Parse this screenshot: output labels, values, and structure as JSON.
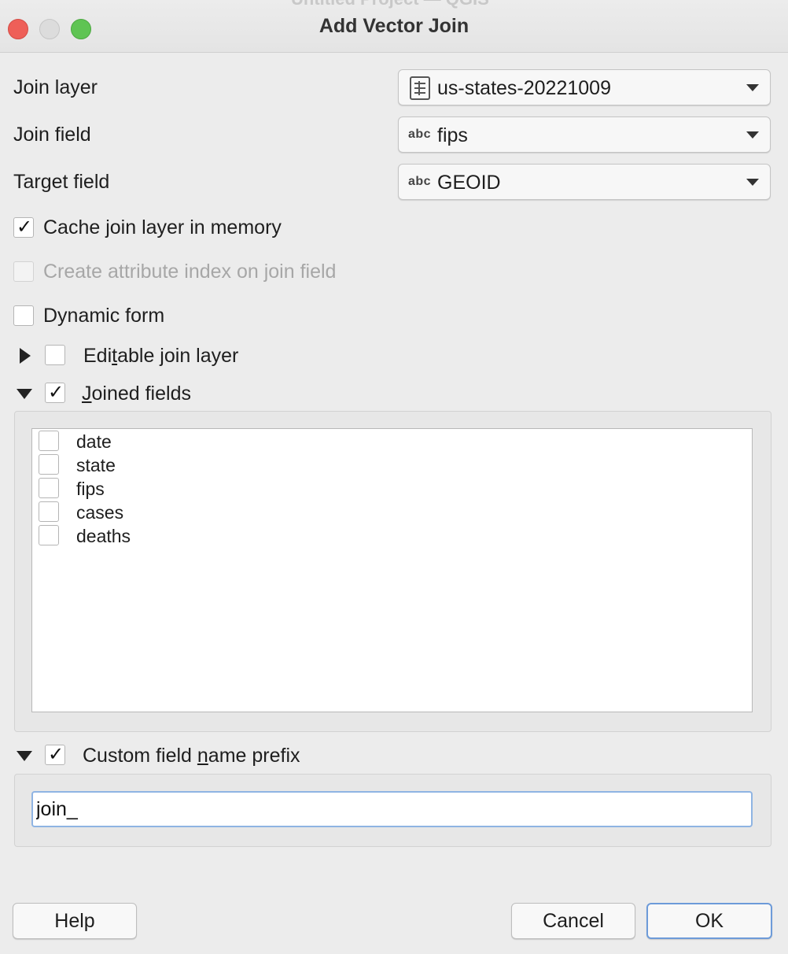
{
  "window": {
    "title": "Add Vector Join",
    "background_title": "Untitled Project — QGIS"
  },
  "form": {
    "join_layer": {
      "label": "Join layer",
      "value": "us-states-20221009",
      "icon": "table-layer-icon"
    },
    "join_field": {
      "label": "Join field",
      "value": "fips",
      "type_badge": "abc"
    },
    "target_field": {
      "label": "Target field",
      "value": "GEOID",
      "type_badge": "abc"
    }
  },
  "options": {
    "cache": {
      "label": "Cache join layer in memory",
      "checked": true
    },
    "attr_index": {
      "label": "Create attribute index on join field",
      "checked": false,
      "enabled": false
    },
    "dynamic_form": {
      "label": "Dynamic form",
      "checked": false
    }
  },
  "groups": {
    "editable": {
      "label_pre": "Edi",
      "label_mnemonic": "t",
      "label_post": "able join layer",
      "checked": false,
      "expanded": false
    },
    "joined_fields": {
      "label_pre": "",
      "label_mnemonic": "J",
      "label_post": "oined fields",
      "checked": true,
      "expanded": true,
      "fields": [
        {
          "name": "date",
          "checked": false
        },
        {
          "name": "state",
          "checked": false
        },
        {
          "name": "fips",
          "checked": false
        },
        {
          "name": "cases",
          "checked": false
        },
        {
          "name": "deaths",
          "checked": false
        }
      ]
    },
    "prefix": {
      "label_pre": "Custom field ",
      "label_mnemonic": "n",
      "label_post": "ame prefix",
      "checked": true,
      "expanded": true,
      "value": "join_"
    }
  },
  "buttons": {
    "help": "Help",
    "cancel": "Cancel",
    "ok": "OK"
  },
  "colors": {
    "close": "#ee5f58",
    "minimize": "#dcdcdc",
    "maximize": "#5fc453",
    "focus": "#6d9bd9"
  }
}
